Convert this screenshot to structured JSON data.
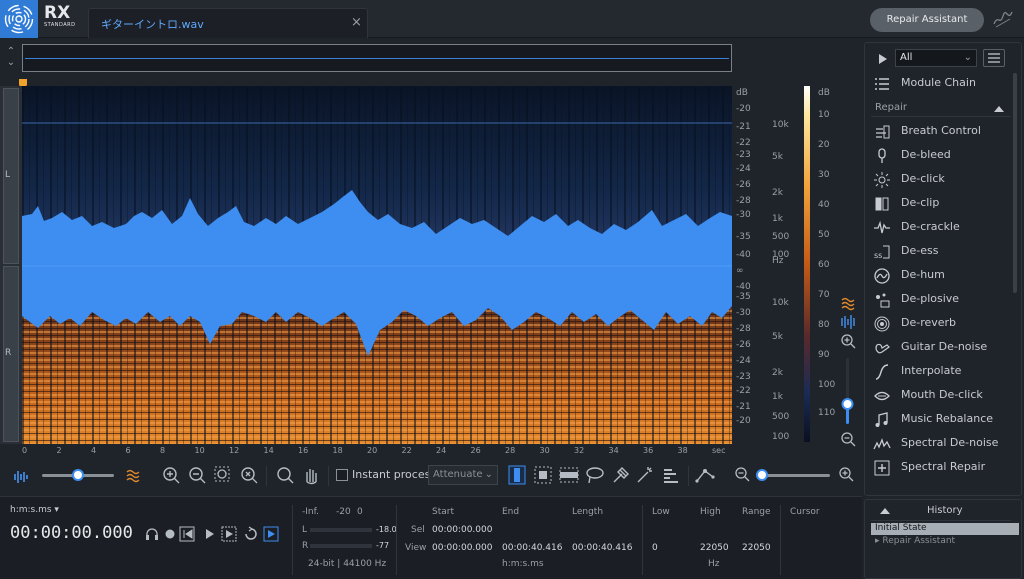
{
  "app": {
    "logo_text": "RX",
    "logo_sub": "STANDARD",
    "repair_assistant": "Repair Assistant"
  },
  "file_tab": {
    "name": "ギターイントロ.wav",
    "close": "×"
  },
  "channels": {
    "left": "L",
    "right": "R"
  },
  "db_scale": [
    "dB",
    "-20",
    "-21",
    "-22",
    "-23",
    "-24",
    "-26",
    "-28",
    "-30",
    "-35",
    "-40",
    "∞",
    "-40",
    "-35",
    "-30",
    "-28",
    "-26",
    "-24",
    "-23",
    "-22",
    "-21",
    "-20"
  ],
  "hz_scale": [
    "10k",
    "5k",
    "2k",
    "1k",
    "500",
    "100",
    "Hz",
    "10k",
    "5k",
    "2k",
    "1k",
    "500",
    "100"
  ],
  "color_scale": [
    "dB",
    "10",
    "20",
    "30",
    "40",
    "50",
    "60",
    "70",
    "80",
    "90",
    "100",
    "110"
  ],
  "time_ruler": [
    "0",
    "2",
    "4",
    "6",
    "8",
    "10",
    "12",
    "14",
    "16",
    "18",
    "20",
    "22",
    "24",
    "26",
    "28",
    "30",
    "32",
    "34",
    "36",
    "38",
    "sec"
  ],
  "toolbar": {
    "instant_process": "Instant process",
    "attenuate": "Attenuate"
  },
  "status": {
    "time_format": "h:m:s.ms",
    "time": "00:00:00.000",
    "meter": {
      "inf": "-Inf.",
      "m20": "-20",
      "zero": "0",
      "l": "L",
      "r": "R",
      "l_peak": "-18.0",
      "r_peak": "-77",
      "format": "24-bit | 44100 Hz"
    },
    "sel_view": {
      "start": "Start",
      "end": "End",
      "length": "Length",
      "sel": "Sel",
      "view": "View",
      "sel_start": "00:00:00.000",
      "view_start": "00:00:00.000",
      "view_end": "00:00:40.416",
      "view_length": "00:00:40.416",
      "unit": "h:m:s.ms"
    },
    "freq": {
      "low": "Low",
      "high": "High",
      "range": "Range",
      "low_val": "0",
      "high_val": "22050",
      "range_val": "22050",
      "unit": "Hz"
    },
    "cursor": "Cursor"
  },
  "module_panel": {
    "filter": "All",
    "module_chain": "Module Chain",
    "section": "Repair",
    "items": [
      "Breath Control",
      "De-bleed",
      "De-click",
      "De-clip",
      "De-crackle",
      "De-ess",
      "De-hum",
      "De-plosive",
      "De-reverb",
      "Guitar De-noise",
      "Interpolate",
      "Mouth De-click",
      "Music Rebalance",
      "Spectral De-noise",
      "Spectral Repair"
    ]
  },
  "history": {
    "title": "History",
    "items": [
      "Initial State",
      "Repair Assistant"
    ]
  }
}
